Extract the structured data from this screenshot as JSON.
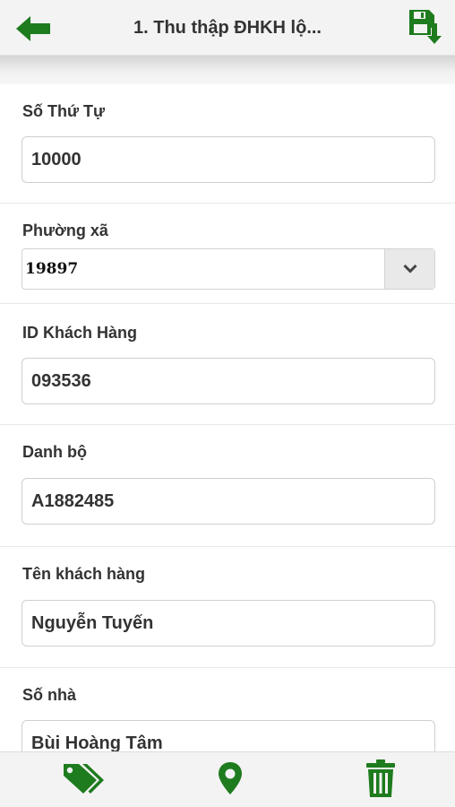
{
  "header": {
    "title": "1. Thu thập ĐHKH lộ...",
    "back_icon": "arrow-left-icon",
    "save_icon": "save-download-icon"
  },
  "form": {
    "so_thu_tu": {
      "label": "Số Thứ Tự",
      "value": "10000"
    },
    "phuong_xa": {
      "label": "Phường xã",
      "selected": "19897"
    },
    "id_khach_hang": {
      "label": "ID Khách Hàng",
      "value": "093536"
    },
    "danh_bo": {
      "label": "Danh bộ",
      "value": "A1882485"
    },
    "ten_khach_hang": {
      "label": "Tên khách hàng",
      "value": "Nguyễn Tuyến"
    },
    "so_nha": {
      "label": "Số nhà",
      "value": "Bùi Hoàng Tâm"
    }
  },
  "toolbar": {
    "tags_icon": "tags-icon",
    "location_icon": "map-marker-icon",
    "delete_icon": "trash-icon"
  },
  "colors": {
    "accent": "#1e7b1e",
    "header_bg": "#f3f3f3",
    "border": "#cfcfcf"
  }
}
